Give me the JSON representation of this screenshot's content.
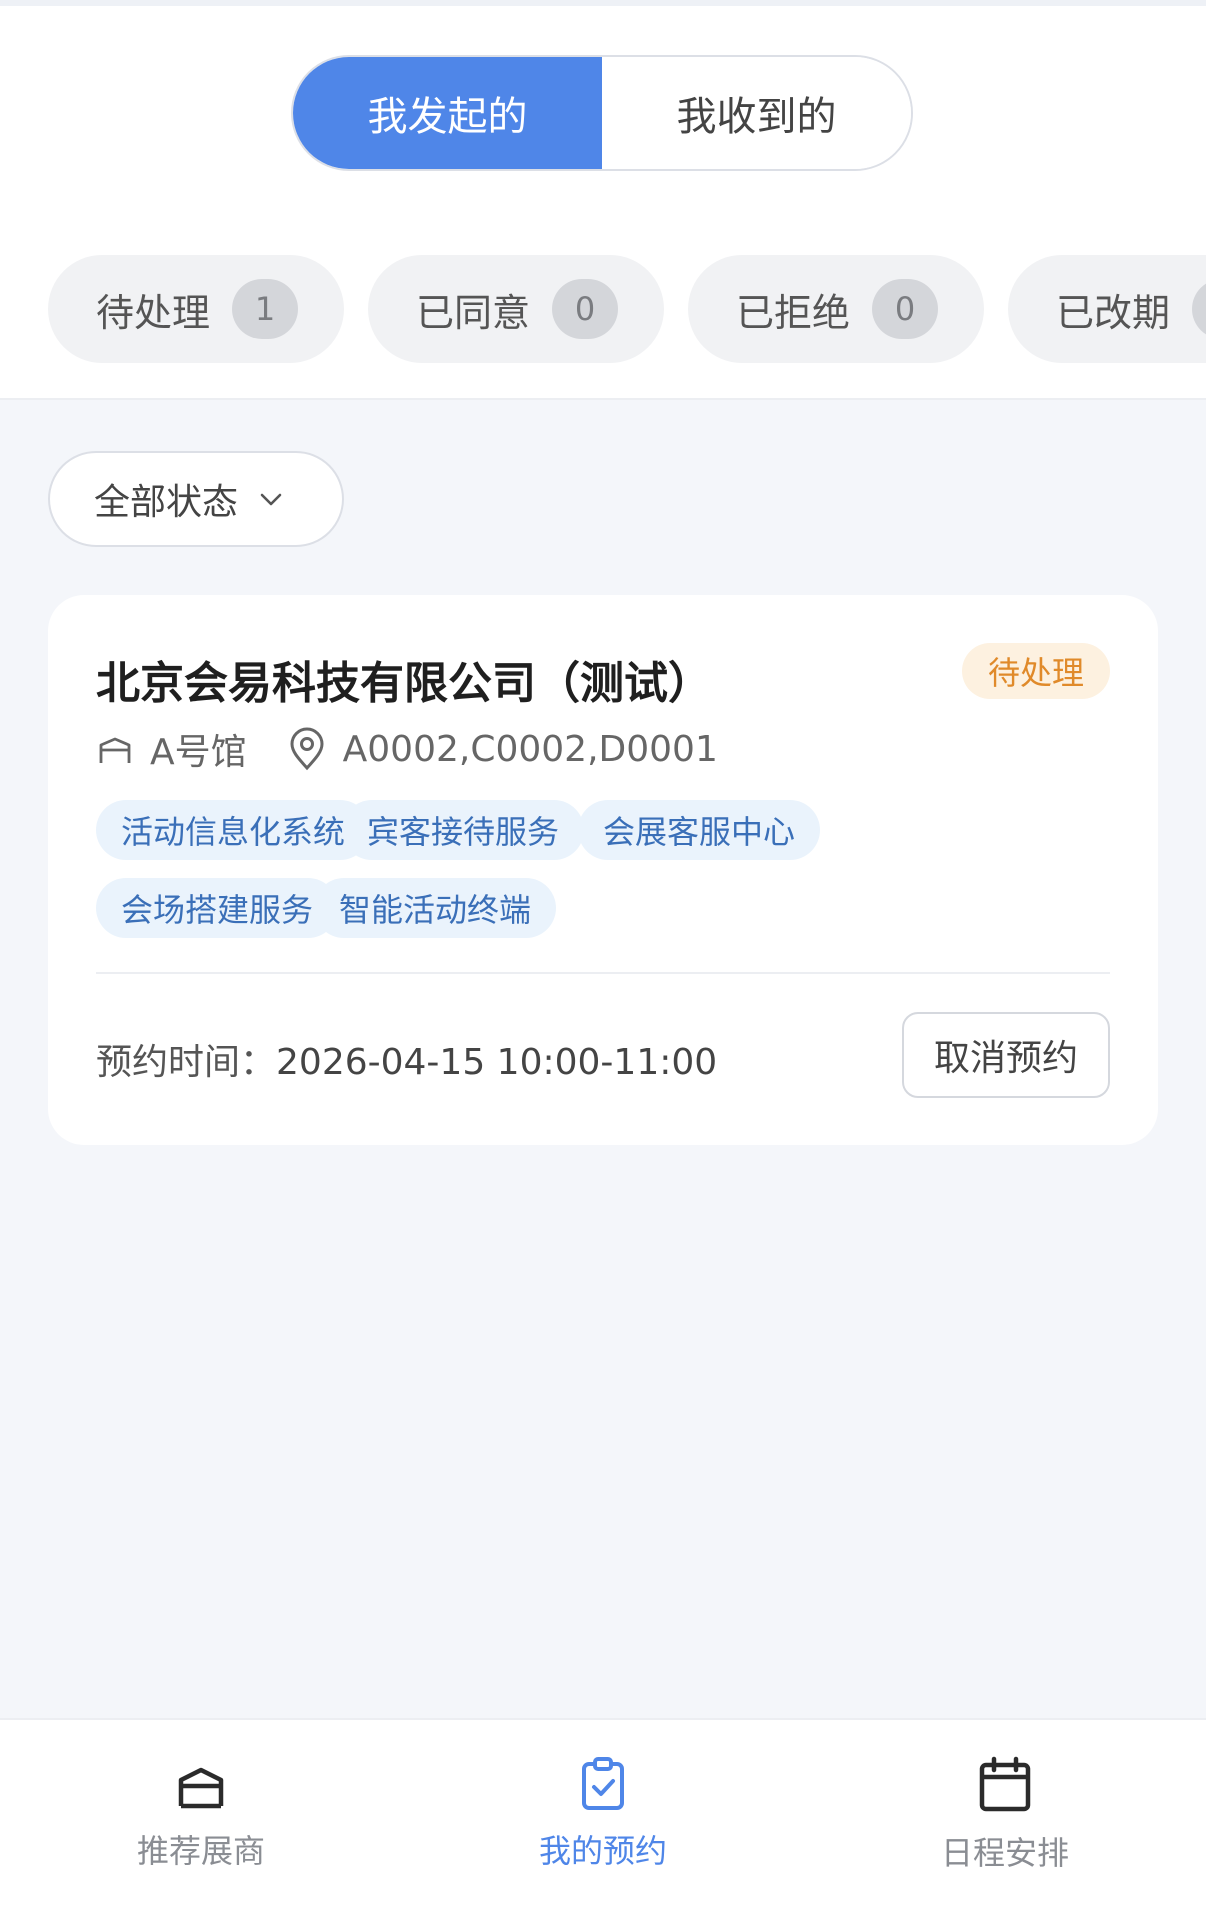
{
  "segmented": {
    "tabs": [
      {
        "label": "我发起的",
        "active": true
      },
      {
        "label": "我收到的",
        "active": false
      }
    ]
  },
  "status_filters": [
    {
      "label": "待处理",
      "count": "1"
    },
    {
      "label": "已同意",
      "count": "0"
    },
    {
      "label": "已拒绝",
      "count": "0"
    },
    {
      "label": "已改期",
      "count": ""
    }
  ],
  "filter": {
    "label": "全部状态",
    "icon": "chevron-down-icon"
  },
  "card": {
    "title": "北京会易科技有限公司（测试）",
    "status": "待处理",
    "hall": "A号馆",
    "booths": "A0002,C0002,D0001",
    "tags": [
      "活动信息化系统",
      "宾客接待服务",
      "会展客服中心",
      "会场搭建服务",
      "智能活动终端"
    ],
    "time_label": "预约时间：",
    "time_value": "2026-04-15 10:00-11:00",
    "cancel_label": "取消预约"
  },
  "tabbar": {
    "items": [
      {
        "label": "推荐展商",
        "icon": "exhibitor-icon",
        "active": false
      },
      {
        "label": "我的预约",
        "icon": "clipboard-check-icon",
        "active": true
      },
      {
        "label": "日程安排",
        "icon": "calendar-icon",
        "active": false
      }
    ]
  },
  "colors": {
    "accent": "#4f86e8",
    "pending": "#e08a2a",
    "tag_text": "#3a6fb8"
  }
}
